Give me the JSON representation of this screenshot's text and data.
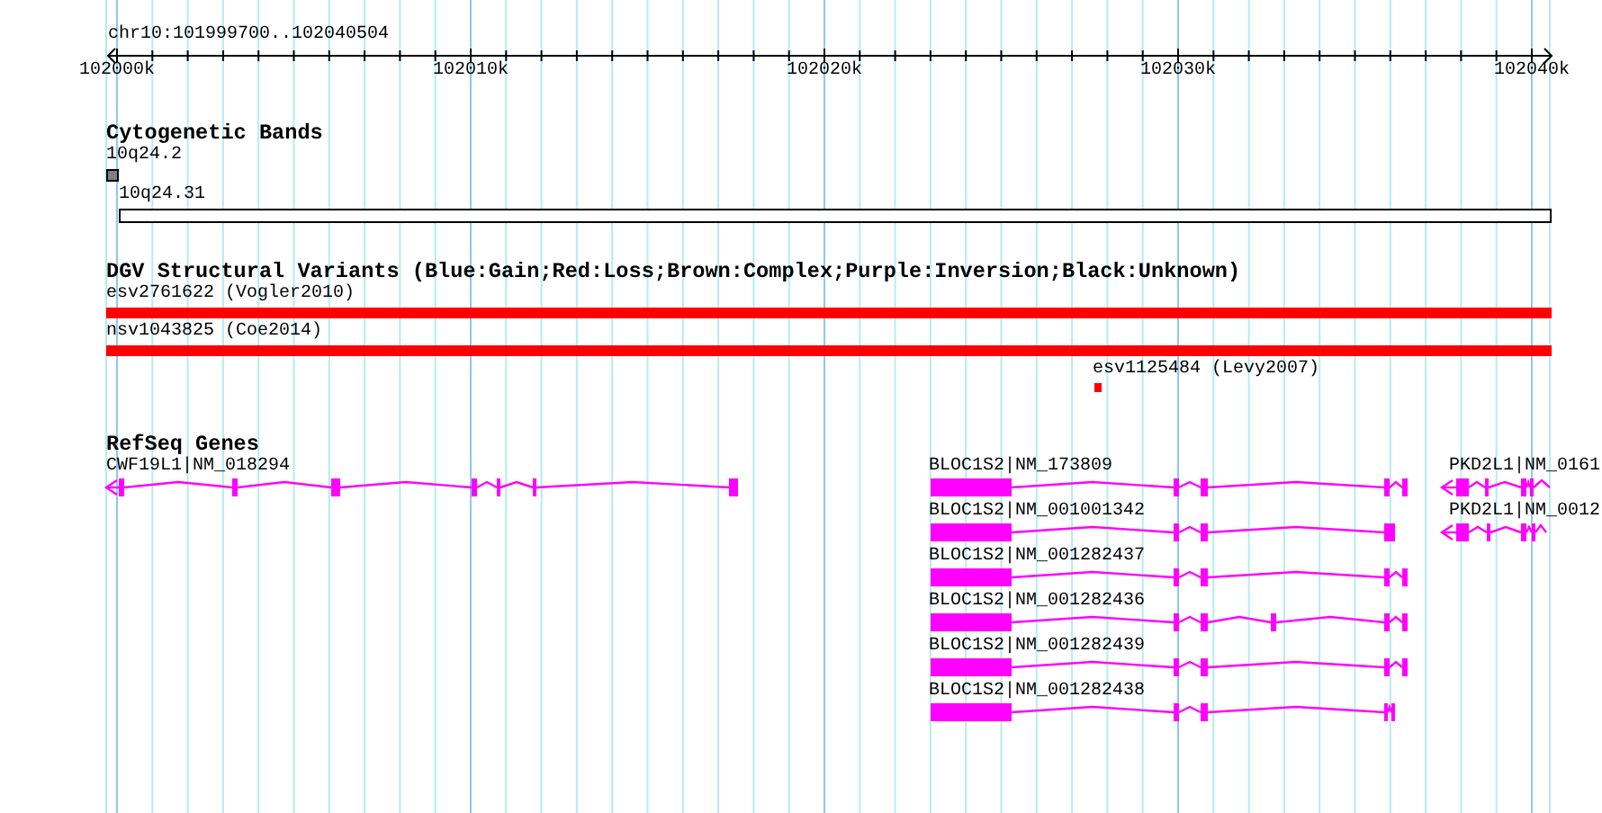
{
  "ruler": {
    "range": "chr10:101999700..102040504",
    "ticks": [
      "102000k",
      "102010k",
      "102020k",
      "102030k",
      "102040k"
    ]
  },
  "tracks": [
    {
      "kind": "bands",
      "title": "Cytogenetic Bands",
      "features": [
        {
          "label": "10q24.2",
          "color": "#808080"
        },
        {
          "label": "10q24.31",
          "color": "#ffffff"
        }
      ]
    },
    {
      "kind": "variants",
      "title": "DGV Structural Variants (Blue:Gain;Red:Loss;Brown:Complex;Purple:Inversion;Black:Unknown)",
      "features": [
        {
          "label": "esv2761622 (Vogler2010)",
          "color": "#ff0000"
        },
        {
          "label": "nsv1043825 (Coe2014)",
          "color": "#ff0000"
        },
        {
          "label": "esv1125484 (Levy2007)",
          "color": "#ff0000"
        }
      ]
    },
    {
      "kind": "genes",
      "title": "RefSeq Genes",
      "features": [
        {
          "label": "CWF19L1|NM_018294"
        },
        {
          "label": "BLOC1S2|NM_173809"
        },
        {
          "label": "BLOC1S2|NM_001001342"
        },
        {
          "label": "BLOC1S2|NM_001282437"
        },
        {
          "label": "BLOC1S2|NM_001282436"
        },
        {
          "label": "BLOC1S2|NM_001282439"
        },
        {
          "label": "BLOC1S2|NM_001282438"
        },
        {
          "label": "PKD2L1|NM_0161"
        },
        {
          "label": "PKD2L1|NM_0012"
        }
      ]
    }
  ]
}
